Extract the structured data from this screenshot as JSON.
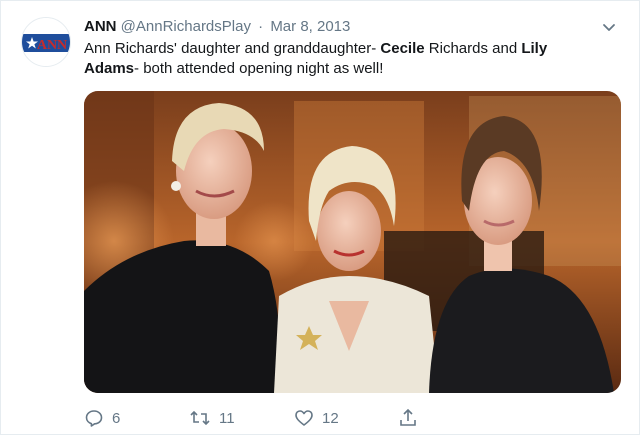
{
  "tweet": {
    "author": {
      "name": "ANN",
      "handle": "@AnnRichardsPlay",
      "avatar_text": "ANN",
      "avatar_colors": {
        "red": "#c62b2b",
        "blue": "#1f4e9c",
        "white": "#ffffff"
      }
    },
    "separator": "·",
    "date": "Mar 8, 2013",
    "text": {
      "part1": "Ann Richards' daughter and granddaughter- ",
      "bold1": "Cecile",
      "part2": " Richards and ",
      "bold2": "Lily",
      "bold3": "Adams",
      "part3": "- both attended opening night as well!"
    },
    "actions": {
      "reply_count": "6",
      "retweet_count": "11",
      "like_count": "12",
      "reply_icon": "reply-icon",
      "retweet_icon": "retweet-icon",
      "like_icon": "heart-icon",
      "share_icon": "share-icon"
    }
  },
  "colors": {
    "text": "#14171a",
    "secondary": "#657786",
    "border": "#e6ecf0"
  }
}
